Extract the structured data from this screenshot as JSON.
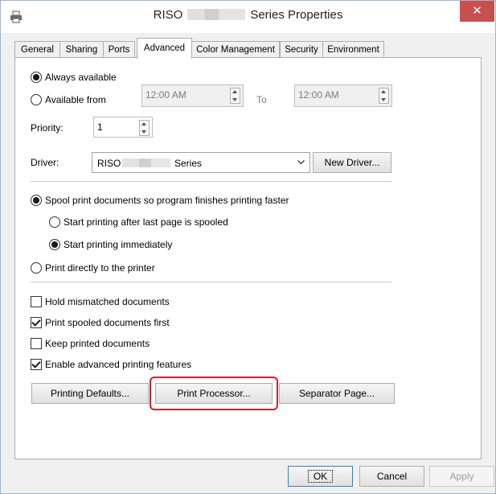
{
  "window": {
    "title_prefix": "RISO",
    "title_suffix": "Series Properties",
    "close_glyph": "✕"
  },
  "tabs": [
    {
      "label": "General"
    },
    {
      "label": "Sharing"
    },
    {
      "label": "Ports"
    },
    {
      "label": "Advanced",
      "active": true
    },
    {
      "label": "Color Management"
    },
    {
      "label": "Security"
    },
    {
      "label": "Environment"
    }
  ],
  "availability": {
    "always_label": "Always available",
    "from_label": "Available from",
    "from_time": "12:00 AM",
    "to_label": "To",
    "to_time": "12:00 AM"
  },
  "priority": {
    "label": "Priority:",
    "value": "1"
  },
  "driver": {
    "label": "Driver:",
    "value_prefix": "RISO",
    "value_suffix": "Series",
    "new_driver_label": "New Driver..."
  },
  "spool": {
    "spool_label": "Spool print documents so program finishes printing faster",
    "after_last_label": "Start printing after last page is spooled",
    "immediately_label": "Start printing immediately",
    "direct_label": "Print directly to the printer"
  },
  "options": [
    {
      "label": "Hold mismatched documents",
      "checked": false
    },
    {
      "label": "Print spooled documents first",
      "checked": true
    },
    {
      "label": "Keep printed documents",
      "checked": false
    },
    {
      "label": "Enable advanced printing features",
      "checked": true
    }
  ],
  "buttons": {
    "printing_defaults": "Printing Defaults...",
    "print_processor": "Print Processor...",
    "separator_page": "Separator Page...",
    "ok": "OK",
    "cancel": "Cancel",
    "apply": "Apply"
  },
  "colors": {
    "highlight": "#cf2027",
    "close_button": "#c7504f"
  }
}
